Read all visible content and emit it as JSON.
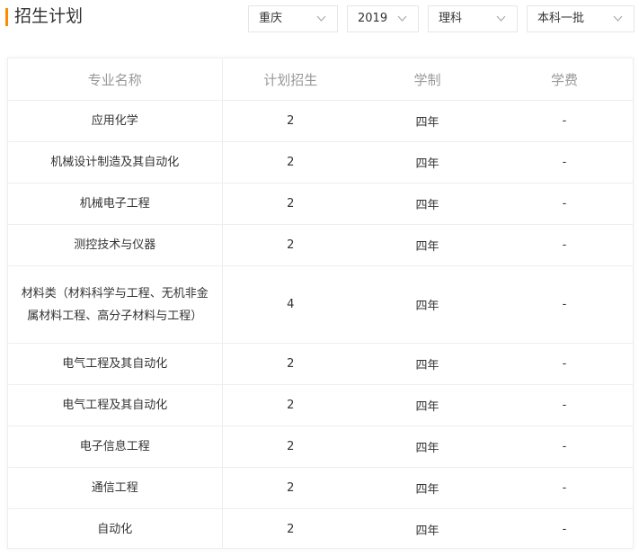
{
  "header": {
    "title": "招生计划",
    "accent_color": "#ff8a00",
    "filters": [
      {
        "label": "重庆",
        "icon": "chevron-down-icon"
      },
      {
        "label": "2019",
        "icon": "chevron-down-icon"
      },
      {
        "label": "理科",
        "icon": "chevron-down-icon"
      },
      {
        "label": "本科一批",
        "icon": "chevron-down-icon"
      }
    ]
  },
  "table": {
    "columns": [
      "专业名称",
      "计划招生",
      "学制",
      "学费"
    ],
    "rows": [
      {
        "major": "应用化学",
        "plan": "2",
        "duration": "四年",
        "fee": "-"
      },
      {
        "major": "机械设计制造及其自动化",
        "plan": "2",
        "duration": "四年",
        "fee": "-"
      },
      {
        "major": "机械电子工程",
        "plan": "2",
        "duration": "四年",
        "fee": "-"
      },
      {
        "major": "测控技术与仪器",
        "plan": "2",
        "duration": "四年",
        "fee": "-"
      },
      {
        "major": "材料类（材料科学与工程、无机非金属材料工程、高分子材料与工程）",
        "plan": "4",
        "duration": "四年",
        "fee": "-"
      },
      {
        "major": "电气工程及其自动化",
        "plan": "2",
        "duration": "四年",
        "fee": "-"
      },
      {
        "major": "电气工程及其自动化",
        "plan": "2",
        "duration": "四年",
        "fee": "-"
      },
      {
        "major": "电子信息工程",
        "plan": "2",
        "duration": "四年",
        "fee": "-"
      },
      {
        "major": "通信工程",
        "plan": "2",
        "duration": "四年",
        "fee": "-"
      },
      {
        "major": "自动化",
        "plan": "2",
        "duration": "四年",
        "fee": "-"
      }
    ]
  }
}
